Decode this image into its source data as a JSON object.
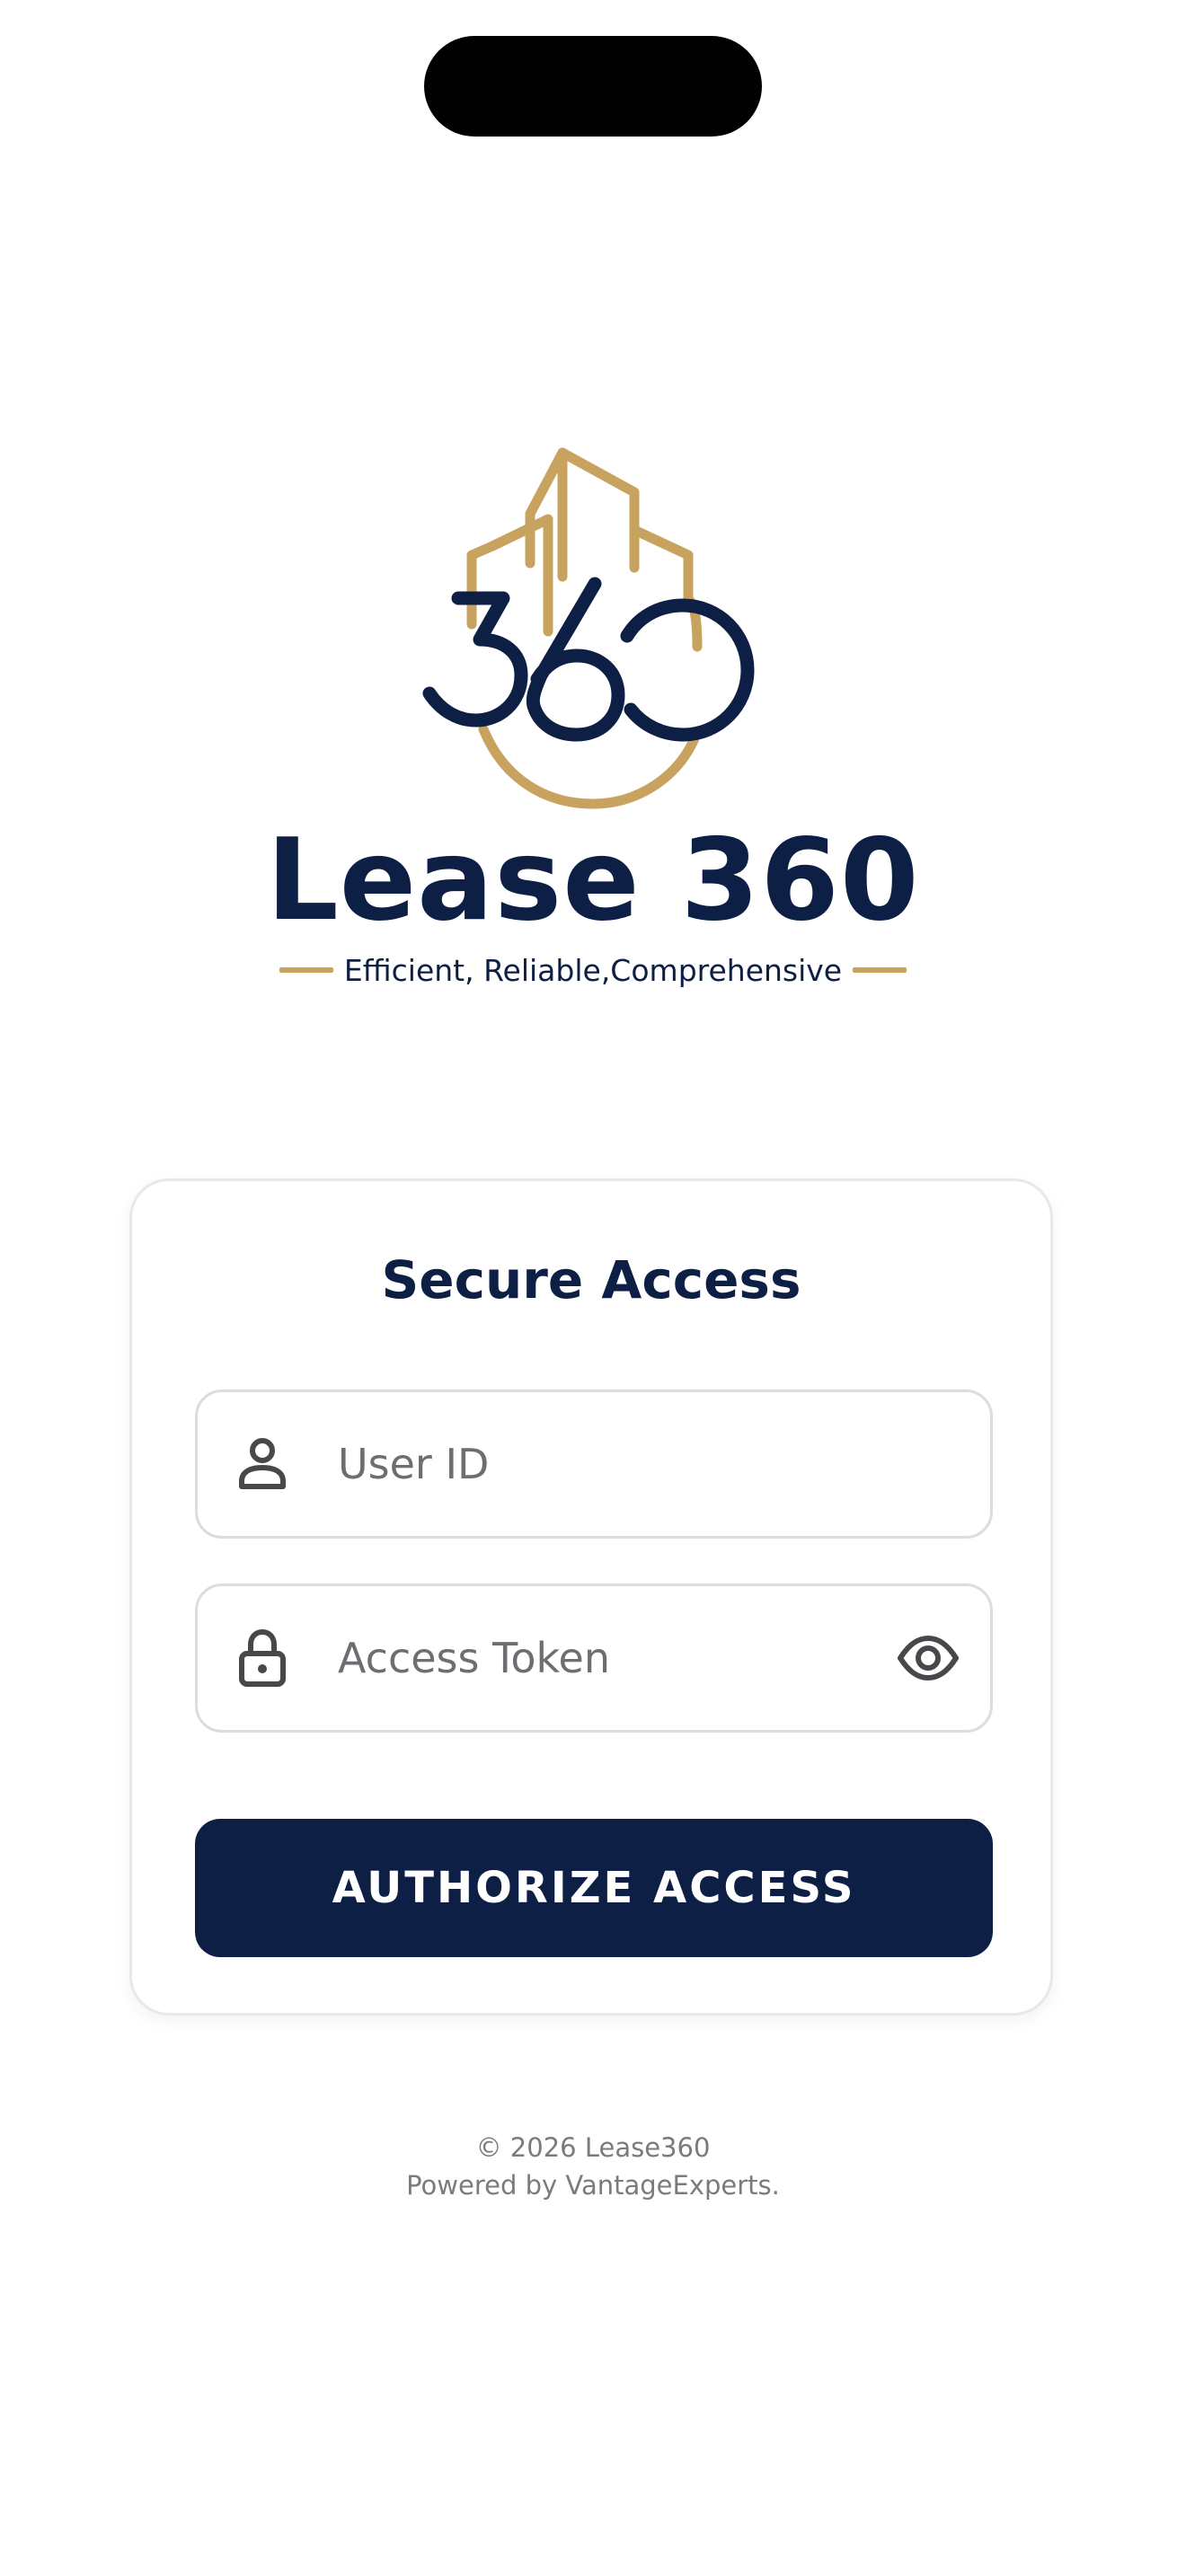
{
  "brand": {
    "logo_text": "360",
    "title": "Lease 360",
    "tagline": "Efficient, Reliable,Comprehensive"
  },
  "login": {
    "title": "Secure Access",
    "user_id_placeholder": "User ID",
    "access_token_placeholder": "Access Token",
    "authorize_label": "AUTHORIZE ACCESS"
  },
  "footer": {
    "copyright": "© 2026 Lease360",
    "powered_by": "Powered by VantageExperts."
  },
  "colors": {
    "navy": "#0d1f44",
    "gold": "#c8a35f",
    "field_border": "#dcdcdf",
    "placeholder": "#6d6d72"
  },
  "icons": {
    "user_field": "person-icon",
    "token_field": "lock-icon",
    "visibility_toggle": "eye-icon"
  }
}
